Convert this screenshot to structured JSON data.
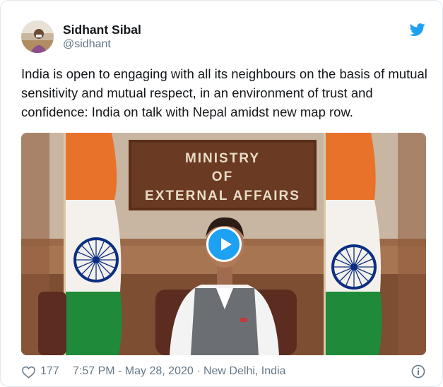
{
  "author": {
    "name": "Sidhant Sibal",
    "handle": "@sidhant"
  },
  "tweet": {
    "text": "India is open to engaging with all its neighbours on the basis of mutual sensitivity and mutual respect, in an environment of trust and confidence: India on talk with Nepal amidst new map row."
  },
  "media": {
    "sign_line_1": "MINISTRY",
    "sign_line_2": "OF",
    "sign_line_3": "EXTERNAL AFFAIRS",
    "type": "video"
  },
  "footer": {
    "likes": "177",
    "timestamp": "7:57 PM - May 28, 2020 · New Delhi, India"
  },
  "icons": {
    "brand": "twitter-bird-icon",
    "like": "heart-icon",
    "info": "info-icon",
    "play": "play-icon"
  },
  "colors": {
    "accent": "#1da1f2",
    "text": "#14171a",
    "secondary": "#657786",
    "flag_saffron": "#e9722a",
    "flag_green": "#1f8a3a",
    "chakra": "#0b2f82"
  }
}
